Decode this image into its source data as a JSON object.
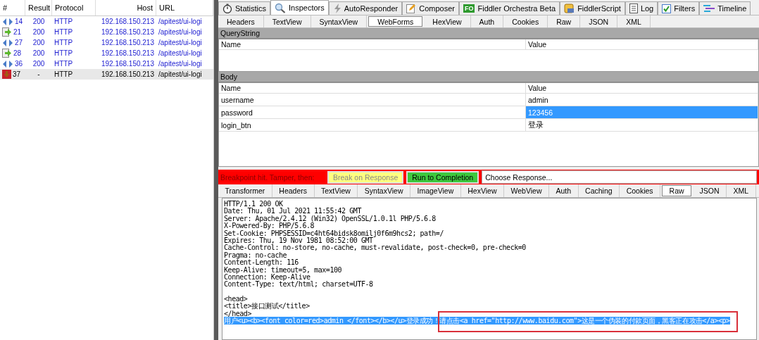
{
  "sessions": {
    "columns": [
      "#",
      "Result",
      "Protocol",
      "Host",
      "URL"
    ],
    "rows": [
      {
        "kind": "get",
        "id": "14",
        "result": "200",
        "protocol": "HTTP",
        "host": "192.168.150.213",
        "url": "/apitest/ui-logi",
        "selected": false
      },
      {
        "kind": "post",
        "id": "21",
        "result": "200",
        "protocol": "HTTP",
        "host": "192.168.150.213",
        "url": "/apitest/ui-logi",
        "selected": false
      },
      {
        "kind": "get",
        "id": "27",
        "result": "200",
        "protocol": "HTTP",
        "host": "192.168.150.213",
        "url": "/apitest/ui-logi",
        "selected": false
      },
      {
        "kind": "post",
        "id": "28",
        "result": "200",
        "protocol": "HTTP",
        "host": "192.168.150.213",
        "url": "/apitest/ui-logi",
        "selected": false
      },
      {
        "kind": "get",
        "id": "36",
        "result": "200",
        "protocol": "HTTP",
        "host": "192.168.150.213",
        "url": "/apitest/ui-logi",
        "selected": false
      },
      {
        "kind": "breakpoint",
        "id": "37",
        "result": "-",
        "protocol": "HTTP",
        "host": "192.168.150.213",
        "url": "/apitest/ui-logi",
        "selected": true
      }
    ]
  },
  "main_tabs": [
    {
      "kind": "stopwatch",
      "label": "Statistics",
      "selected": false
    },
    {
      "kind": "magnifier",
      "label": "Inspectors",
      "selected": true
    },
    {
      "kind": "lightning",
      "label": "AutoResponder",
      "selected": false
    },
    {
      "kind": "pencil",
      "label": "Composer",
      "selected": false
    },
    {
      "kind": "badge",
      "badge": "FO",
      "label": "Fiddler Orchestra Beta",
      "selected": false
    },
    {
      "kind": "script",
      "label": "FiddlerScript",
      "selected": false
    },
    {
      "kind": "log",
      "label": "Log",
      "selected": false
    },
    {
      "kind": "check",
      "label": "Filters",
      "selected": false
    },
    {
      "kind": "timeline",
      "label": "Timeline",
      "selected": false
    }
  ],
  "request_tabs": [
    {
      "label": "Headers",
      "selected": false
    },
    {
      "label": "TextView",
      "selected": false
    },
    {
      "label": "SyntaxView",
      "selected": false
    },
    {
      "label": "WebForms",
      "selected": true
    },
    {
      "label": "HexView",
      "selected": false
    },
    {
      "label": "Auth",
      "selected": false
    },
    {
      "label": "Cookies",
      "selected": false
    },
    {
      "label": "Raw",
      "selected": false
    },
    {
      "label": "JSON",
      "selected": false
    },
    {
      "label": "XML",
      "selected": false
    }
  ],
  "querystring": {
    "title": "QueryString",
    "columns": [
      "Name",
      "Value"
    ]
  },
  "body": {
    "title": "Body",
    "columns": [
      "Name",
      "Value"
    ],
    "rows": [
      {
        "name": "username",
        "value": "admin",
        "selected": false
      },
      {
        "name": "password",
        "value": "123456",
        "selected": true
      },
      {
        "name": "login_btn",
        "value": "登录",
        "selected": false
      }
    ]
  },
  "breakpoint_bar": {
    "label": "Breakpoint hit. Tamper, then:",
    "buttons": [
      {
        "kind": "break",
        "label": "Break on Response",
        "disabled": true
      },
      {
        "kind": "run",
        "label": "Run to Completion",
        "disabled": false
      }
    ],
    "dropdown": "Choose Response..."
  },
  "response_tabs": [
    {
      "label": "Transformer",
      "selected": false
    },
    {
      "label": "Headers",
      "selected": false
    },
    {
      "label": "TextView",
      "selected": false
    },
    {
      "label": "SyntaxView",
      "selected": false
    },
    {
      "label": "ImageView",
      "selected": false
    },
    {
      "label": "HexView",
      "selected": false
    },
    {
      "label": "WebView",
      "selected": false
    },
    {
      "label": "Auth",
      "selected": false
    },
    {
      "label": "Caching",
      "selected": false
    },
    {
      "label": "Cookies",
      "selected": false
    },
    {
      "label": "Raw",
      "selected": true
    },
    {
      "label": "JSON",
      "selected": false
    },
    {
      "label": "XML",
      "selected": false
    }
  ],
  "response_lines": [
    {
      "text": "HTTP/1.1 200 OK",
      "selected": false
    },
    {
      "text": "Date: Thu, 01 Jul 2021 11:55:42 GMT",
      "selected": false
    },
    {
      "text": "Server: Apache/2.4.12 (Win32) OpenSSL/1.0.1l PHP/5.6.8",
      "selected": false
    },
    {
      "text": "X-Powered-By: PHP/5.6.8",
      "selected": false
    },
    {
      "text": "Set-Cookie: PHPSESSID=c4ht64bidsk8omilj0f6m9hcs2; path=/",
      "selected": false
    },
    {
      "text": "Expires: Thu, 19 Nov 1981 08:52:00 GMT",
      "selected": false
    },
    {
      "text": "Cache-Control: no-store, no-cache, must-revalidate, post-check=0, pre-check=0",
      "selected": false
    },
    {
      "text": "Pragma: no-cache",
      "selected": false
    },
    {
      "text": "Content-Length: 116",
      "selected": false
    },
    {
      "text": "Keep-Alive: timeout=5, max=100",
      "selected": false
    },
    {
      "text": "Connection: Keep-Alive",
      "selected": false
    },
    {
      "text": "Content-Type: text/html; charset=UTF-8",
      "selected": false
    },
    {
      "text": "<head>",
      "selected": false,
      "gap_before": true
    },
    {
      "text": "<title>接口测试</title>",
      "selected": false
    },
    {
      "text": "</head>",
      "selected": false
    },
    {
      "text": "用户<u><b><font color=red>admin </font></b></u>登录成功！请点击<a href=\"http://www.baidu.com\">这是一个伪装的付款页面，黑客正在攻击</a><p>",
      "selected": true,
      "annotated": true
    }
  ]
}
